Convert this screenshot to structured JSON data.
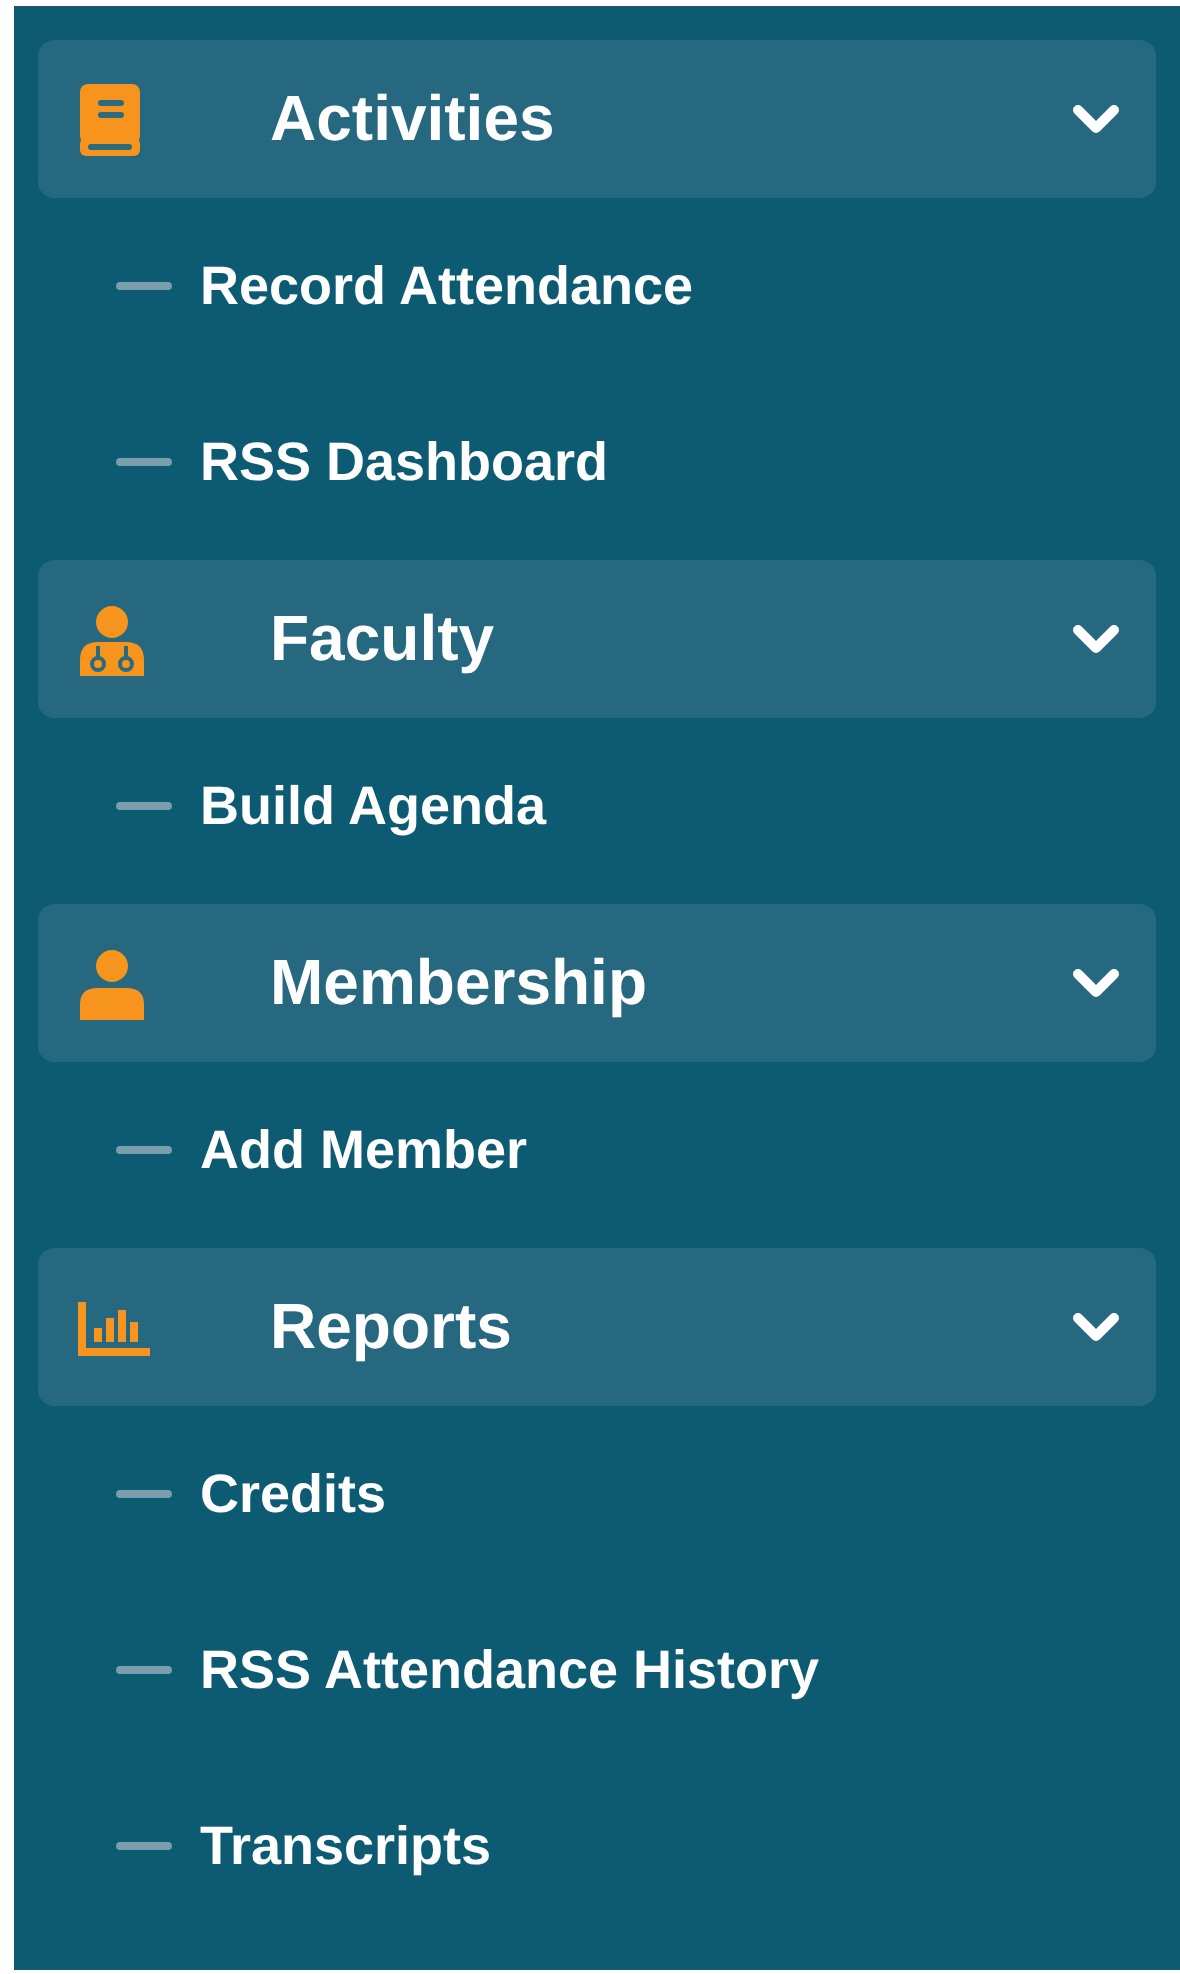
{
  "sidebar": {
    "sections": [
      {
        "kind": "book",
        "label": "Activities",
        "expanded": true,
        "items": [
          {
            "label": "Record Attendance"
          },
          {
            "label": "RSS Dashboard"
          }
        ]
      },
      {
        "kind": "doctor",
        "label": "Faculty",
        "expanded": true,
        "items": [
          {
            "label": "Build Agenda"
          }
        ]
      },
      {
        "kind": "person",
        "label": "Membership",
        "expanded": true,
        "items": [
          {
            "label": "Add Member"
          }
        ]
      },
      {
        "kind": "chart",
        "label": "Reports",
        "expanded": true,
        "items": [
          {
            "label": "Credits"
          },
          {
            "label": "RSS Attendance History"
          },
          {
            "label": "Transcripts"
          }
        ]
      }
    ]
  }
}
